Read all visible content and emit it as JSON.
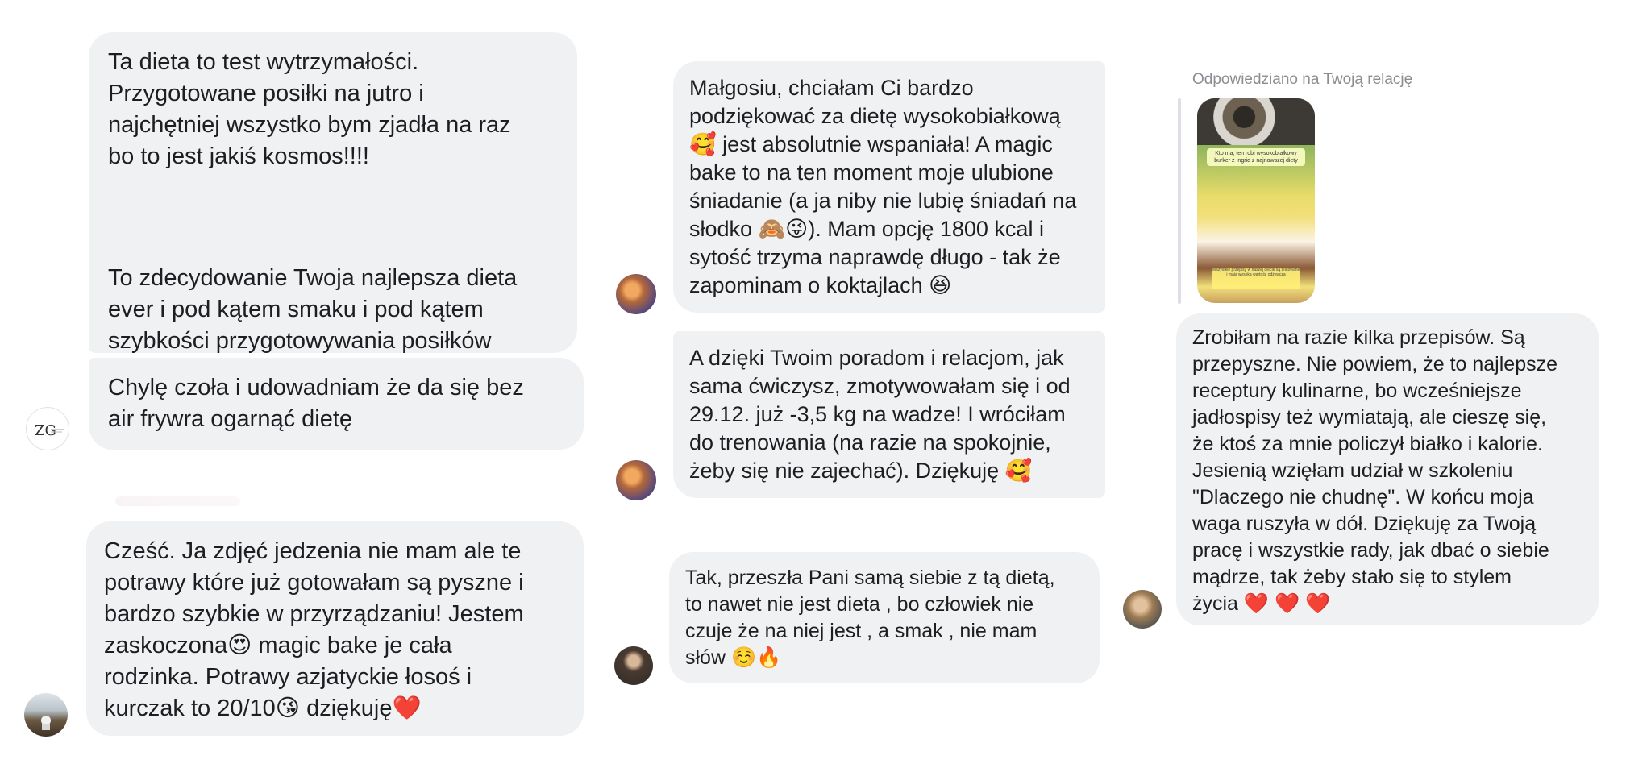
{
  "reply": {
    "label": "Odpowiedziano na Twoją relację"
  },
  "story": {
    "caption": "Kto ma, ten robi wysokobiałkowy burker z Ingrid z najnowszej diety",
    "footer": "Wszystkie przepisy w naszej diecie są testowane i mają wysoką wartość odżywczą"
  },
  "messages": {
    "m1": {
      "text1": "Ta dieta to test wytrzymałości.\nPrzygotowane posiłki na jutro i\nnajchętniej wszystko bym zjadła na raz\nbo to jest jakiś kosmos!!!!",
      "text2": "To zdecydowanie Twoja najlepsza dieta\never i pod kątem smaku i pod kątem\nszybkości przygotowywania posiłków"
    },
    "m2": {
      "text": "Chylę czoła i udowadniam że da się bez\nair frywra ogarnąć dietę"
    },
    "m3": {
      "text": "Cześć. Ja zdjęć jedzenia nie mam ale te\npotrawy które już gotowałam są pyszne i\nbardzo szybkie w przyrządzaniu! Jestem\nzaskoczona😍 magic bake je cała\nrodzinka. Potrawy azjatyckie łosoś i\nkurczak to 20/10😘 dziękuję❤️"
    },
    "m4": {
      "text": "Małgosiu, chciałam Ci bardzo\npodziękować za dietę wysokobiałkową\n🥰 jest absolutnie wspaniała! A magic\nbake to na ten moment moje ulubione\nśniadanie (a ja niby nie lubię śniadań na\nsłodko 🙈😜). Mam opcję 1800 kcal i\nsytość trzyma naprawdę długo - tak że\nzapominam o koktajlach 😆"
    },
    "m5": {
      "text": "A dzięki Twoim poradom i relacjom, jak\nsama ćwiczysz, zmotywowałam się i od\n29.12. już -3,5 kg na wadze! I wróciłam\ndo trenowania (na razie na spokojnie,\nżeby się nie zajechać). Dziękuję 🥰"
    },
    "m6": {
      "text": "Tak, przeszła Pani samą siebie z tą dietą,\nto nawet nie jest dieta , bo człowiek nie\nczuje że na niej jest , a smak , nie mam\nsłów ☺️🔥"
    },
    "m7": {
      "text": "Zrobiłam na razie kilka przepisów. Są\nprzepyszne. Nie powiem, że to najlepsze\nreceptury kulinarne, bo wcześniejsze\njadłospisy też wymiatają, ale cieszę się,\nże ktoś za mnie policzył białko i kalorie.\nJesienią wzięłam udział w szkoleniu\n\"Dlaczego nie chudnę\". W końcu moja\nwaga ruszyła w dół. Dziękuję za Twoją\npracę  i wszystkie rady, jak dbać o siebie\nmądrze, tak żeby stało się to stylem\nżycia ❤️ ❤️ ❤️"
    }
  },
  "colors": {
    "bubble": "#f0f1f3",
    "label": "#8a8d91"
  }
}
